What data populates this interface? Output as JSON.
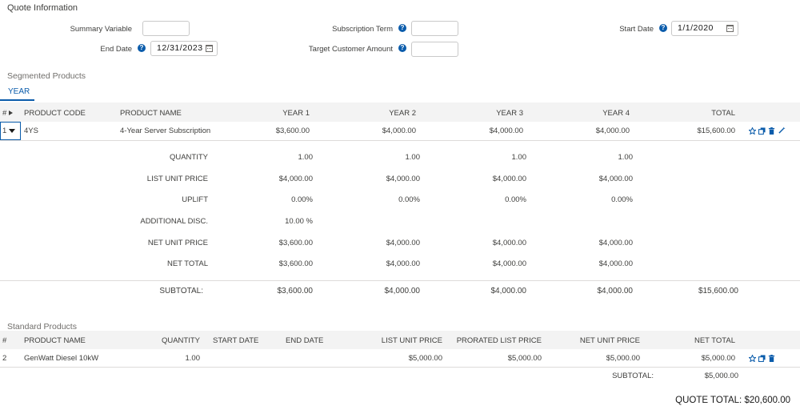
{
  "quote_info": {
    "title": "Quote Information",
    "summary_variable": {
      "label": "Summary Variable",
      "value": ""
    },
    "subscription_term": {
      "label": "Subscription Term",
      "value": ""
    },
    "start_date": {
      "label": "Start Date",
      "value": "1/1/2020"
    },
    "end_date": {
      "label": "End Date",
      "value": "12/31/2023"
    },
    "target_customer_amount": {
      "label": "Target Customer Amount",
      "value": ""
    },
    "help_glyph": "?"
  },
  "segmented": {
    "title": "Segmented Products",
    "tab_label": "YEAR",
    "headers": {
      "num": "#",
      "product_code": "PRODUCT CODE",
      "product_name": "PRODUCT NAME",
      "year1": "YEAR 1",
      "year2": "YEAR 2",
      "year3": "YEAR 3",
      "year4": "YEAR 4",
      "total": "TOTAL"
    },
    "row": {
      "num": "1",
      "product_code": "4YS",
      "product_name": "4-Year Server Subscription",
      "year1": "$3,600.00",
      "year2": "$4,000.00",
      "year3": "$4,000.00",
      "year4": "$4,000.00",
      "total": "$15,600.00"
    },
    "details": [
      {
        "label": "QUANTITY",
        "y1": "1.00",
        "y2": "1.00",
        "y3": "1.00",
        "y4": "1.00"
      },
      {
        "label": "LIST UNIT PRICE",
        "y1": "$4,000.00",
        "y2": "$4,000.00",
        "y3": "$4,000.00",
        "y4": "$4,000.00"
      },
      {
        "label": "UPLIFT",
        "y1": "0.00%",
        "y2": "0.00%",
        "y3": "0.00%",
        "y4": "0.00%"
      },
      {
        "label": "ADDITIONAL DISC.",
        "y1": "10.00 %",
        "y2": "",
        "y3": "",
        "y4": ""
      },
      {
        "label": "NET UNIT PRICE",
        "y1": "$3,600.00",
        "y2": "$4,000.00",
        "y3": "$4,000.00",
        "y4": "$4,000.00"
      },
      {
        "label": "NET TOTAL",
        "y1": "$3,600.00",
        "y2": "$4,000.00",
        "y3": "$4,000.00",
        "y4": "$4,000.00"
      }
    ],
    "subtotal": {
      "label": "SUBTOTAL:",
      "y1": "$3,600.00",
      "y2": "$4,000.00",
      "y3": "$4,000.00",
      "y4": "$4,000.00",
      "total": "$15,600.00"
    }
  },
  "standard": {
    "title": "Standard Products",
    "headers": {
      "num": "#",
      "product_name": "PRODUCT NAME",
      "quantity": "QUANTITY",
      "start_date": "START DATE",
      "end_date": "END DATE",
      "list_unit_price": "LIST UNIT PRICE",
      "prorated_list_price": "PRORATED LIST PRICE",
      "net_unit_price": "NET UNIT PRICE",
      "net_total": "NET TOTAL"
    },
    "row": {
      "num": "2",
      "product_name": "GenWatt Diesel 10kW",
      "quantity": "1.00",
      "start_date": "",
      "end_date": "",
      "list_unit_price": "$5,000.00",
      "prorated_list_price": "$5,000.00",
      "net_unit_price": "$5,000.00",
      "net_total": "$5,000.00"
    },
    "subtotal": {
      "label": "SUBTOTAL:",
      "value": "$5,000.00"
    }
  },
  "quote_total": "QUOTE TOTAL: $20,600.00",
  "icons": [
    "star-icon",
    "copy-icon",
    "trash-icon",
    "magic-wand-icon",
    "calendar-icon",
    "help-icon"
  ],
  "colors": {
    "accent": "#0b5cab",
    "header_band": "#f3f3f3",
    "border": "#dddbda"
  }
}
